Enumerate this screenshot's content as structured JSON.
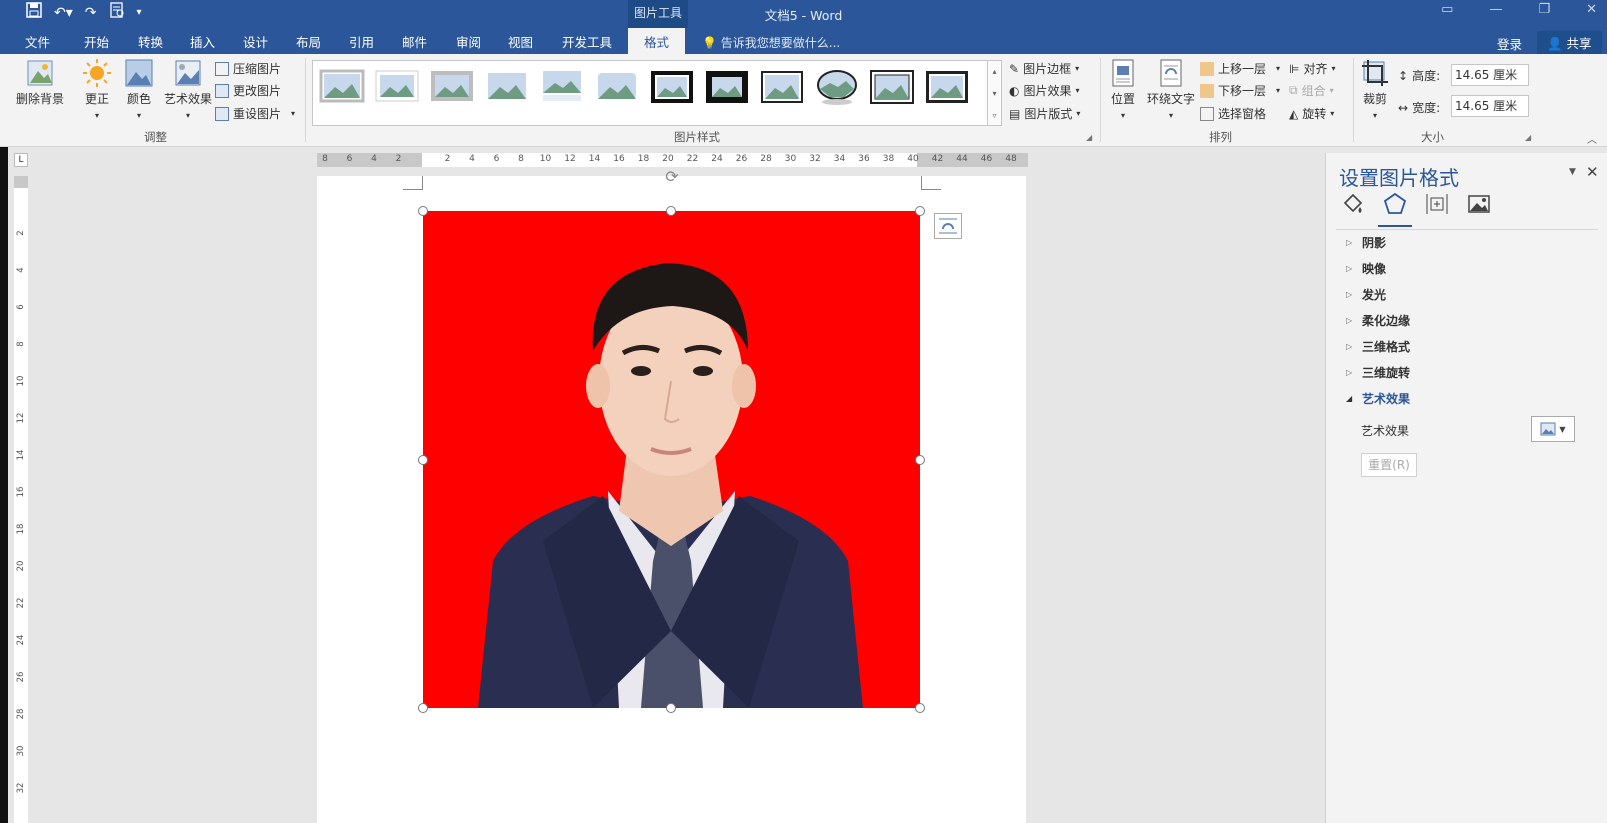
{
  "titlebar": {
    "doc_title": "文档5 - Word",
    "context_tab_group": "图片工具"
  },
  "tabs": [
    {
      "label": "文件"
    },
    {
      "label": "开始"
    },
    {
      "label": "转换"
    },
    {
      "label": "插入"
    },
    {
      "label": "设计"
    },
    {
      "label": "布局"
    },
    {
      "label": "引用"
    },
    {
      "label": "邮件"
    },
    {
      "label": "审阅"
    },
    {
      "label": "视图"
    },
    {
      "label": "开发工具"
    },
    {
      "label": "格式"
    }
  ],
  "tellme": "告诉我您想要做什么...",
  "login": "登录",
  "share": "共享",
  "ribbon": {
    "remove_bg": "删除背景",
    "corrections": "更正",
    "color": "颜色",
    "artistic": "艺术效果",
    "compress": "压缩图片",
    "change": "更改图片",
    "reset": "重设图片",
    "adjust_group": "调整",
    "styles_group": "图片样式",
    "border": "图片边框",
    "effects": "图片效果",
    "layout": "图片版式",
    "position": "位置",
    "wrap": "环绕文字",
    "bring_forward": "上移一层",
    "send_backward": "下移一层",
    "selection_pane": "选择窗格",
    "align": "对齐",
    "group": "组合",
    "rotate": "旋转",
    "arrange_group": "排列",
    "crop": "裁剪",
    "height_label": "高度:",
    "height_value": "14.65 厘米",
    "width_label": "宽度:",
    "width_value": "14.65 厘米",
    "size_group": "大小"
  },
  "ruler": {
    "ticks": [
      "8",
      "6",
      "4",
      "2",
      "",
      "2",
      "4",
      "6",
      "8",
      "10",
      "12",
      "14",
      "16",
      "18",
      "20",
      "22",
      "24",
      "26",
      "28",
      "30",
      "32",
      "34",
      "36",
      "38",
      "40",
      "42",
      "44",
      "46",
      "48"
    ],
    "vticks": [
      "2",
      "4",
      "6",
      "8",
      "10",
      "12",
      "14",
      "16",
      "18",
      "20",
      "22",
      "24",
      "26",
      "28",
      "30",
      "32"
    ]
  },
  "pane": {
    "title": "设置图片格式",
    "sections": [
      {
        "label": "阴影"
      },
      {
        "label": "映像"
      },
      {
        "label": "发光"
      },
      {
        "label": "柔化边缘"
      },
      {
        "label": "三维格式"
      },
      {
        "label": "三维旋转"
      },
      {
        "label": "艺术效果"
      }
    ],
    "art_effect_label": "艺术效果",
    "reset_label": "重置(R)"
  },
  "colors": {
    "accent": "#2b579a",
    "photo_bg": "#ff0000"
  }
}
